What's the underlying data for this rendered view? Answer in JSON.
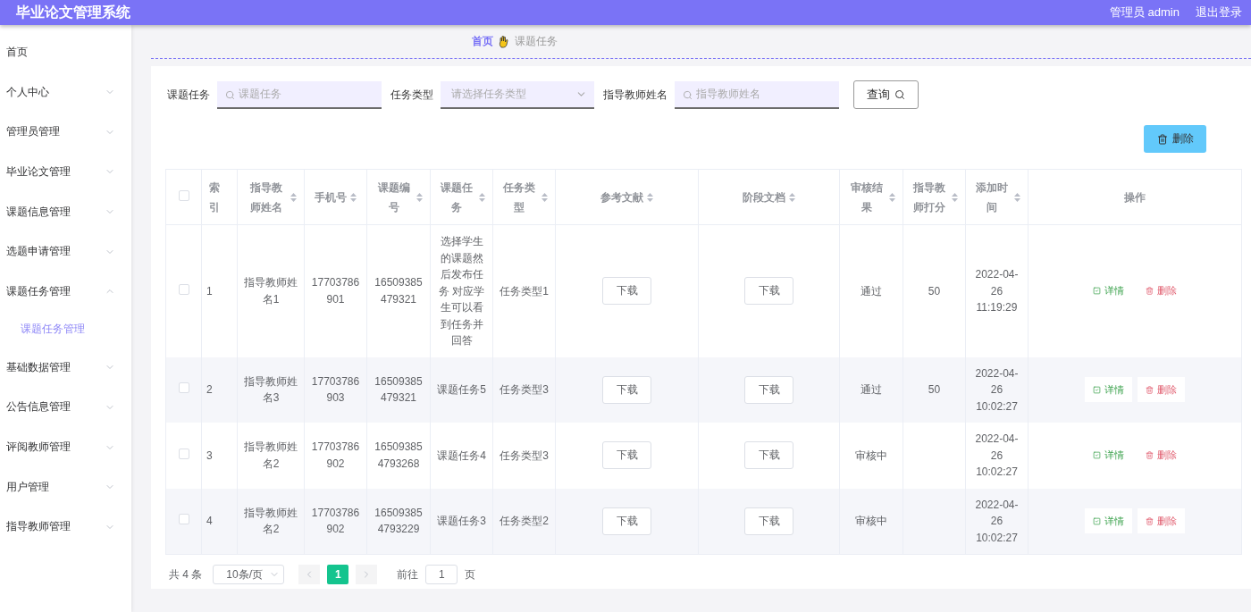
{
  "header": {
    "title": "毕业论文管理系统",
    "user": "管理员 admin",
    "logout": "退出登录"
  },
  "sidebar": {
    "items": [
      {
        "label": "首页",
        "kind": "link"
      },
      {
        "label": "个人中心",
        "kind": "menu",
        "expanded": false
      },
      {
        "label": "管理员管理",
        "kind": "menu",
        "expanded": false
      },
      {
        "label": "毕业论文管理",
        "kind": "menu",
        "expanded": false
      },
      {
        "label": "课题信息管理",
        "kind": "menu",
        "expanded": false
      },
      {
        "label": "选题申请管理",
        "kind": "menu",
        "expanded": false
      },
      {
        "label": "课题任务管理",
        "kind": "menu",
        "expanded": true,
        "children": [
          {
            "label": "课题任务管理",
            "selected": true
          }
        ]
      },
      {
        "label": "基础数据管理",
        "kind": "menu",
        "expanded": false
      },
      {
        "label": "公告信息管理",
        "kind": "menu",
        "expanded": false
      },
      {
        "label": "评阅教师管理",
        "kind": "menu",
        "expanded": false
      },
      {
        "label": "用户管理",
        "kind": "menu",
        "expanded": false
      },
      {
        "label": "指导教师管理",
        "kind": "menu",
        "expanded": false
      }
    ]
  },
  "breadcrumb": [
    "首页",
    "课题任务"
  ],
  "search": {
    "fields": [
      {
        "label": "课题任务",
        "kind": "input",
        "placeholder": "课题任务"
      },
      {
        "label": "任务类型",
        "kind": "select",
        "placeholder": "请选择任务类型"
      },
      {
        "label": "指导教师姓名",
        "kind": "input",
        "placeholder": "指导教师姓名"
      }
    ],
    "button": "查询"
  },
  "delete_button": "删除",
  "table": {
    "select_all": {
      "checked": false
    },
    "columns": [
      {
        "label": "索引",
        "sortable": false
      },
      {
        "label": "指导教师姓名",
        "sortable": true
      },
      {
        "label": "手机号",
        "sortable": true
      },
      {
        "label": "课题编号",
        "sortable": true
      },
      {
        "label": "课题任务",
        "sortable": true
      },
      {
        "label": "任务类型",
        "sortable": true
      },
      {
        "label": "参考文献",
        "sortable": true
      },
      {
        "label": "阶段文档",
        "sortable": true
      },
      {
        "label": "审核结果",
        "sortable": true
      },
      {
        "label": "指导教师打分",
        "sortable": true
      },
      {
        "label": "添加时间",
        "sortable": true
      },
      {
        "label": "操作",
        "sortable": false
      }
    ],
    "rows": [
      {
        "checked": false,
        "index": "1",
        "teacher": "指导教师姓名1",
        "phone": "17703786901",
        "code": "16509385479321",
        "task": "选择学生的课题然后发布任务 对应学生可以看到任务并回答",
        "type": "任务类型1",
        "ref": "下载",
        "doc": "下载",
        "result": "通过",
        "score": "50",
        "time": "2022-04-26 11:19:29",
        "detail": "详情",
        "delete": "删除"
      },
      {
        "checked": false,
        "index": "2",
        "teacher": "指导教师姓名3",
        "phone": "17703786903",
        "code": "16509385479321",
        "task": "课题任务5",
        "type": "任务类型3",
        "ref": "下载",
        "doc": "下载",
        "result": "通过",
        "score": "50",
        "time": "2022-04-26 10:02:27",
        "detail": "详情",
        "delete": "删除"
      },
      {
        "checked": false,
        "index": "3",
        "teacher": "指导教师姓名2",
        "phone": "17703786902",
        "code": "165093854793268",
        "task": "课题任务4",
        "type": "任务类型3",
        "ref": "下载",
        "doc": "下载",
        "result": "审核中",
        "time": "2022-04-26 10:02:27",
        "detail": "详情",
        "delete": "删除"
      },
      {
        "checked": false,
        "index": "4",
        "teacher": "指导教师姓名2",
        "phone": "17703786902",
        "code": "165093854793229",
        "task": "课题任务3",
        "type": "任务类型2",
        "ref": "下载",
        "doc": "下载",
        "result": "审核中",
        "time": "2022-04-26 10:02:27",
        "detail": "详情",
        "delete": "删除"
      }
    ]
  },
  "pagination": {
    "total": "共 4 条",
    "page_size": "10条/页",
    "pages": [
      {
        "label": "1",
        "selected": true
      }
    ],
    "goto": "前往",
    "goto_value": "1",
    "goto_suffix": "页"
  }
}
